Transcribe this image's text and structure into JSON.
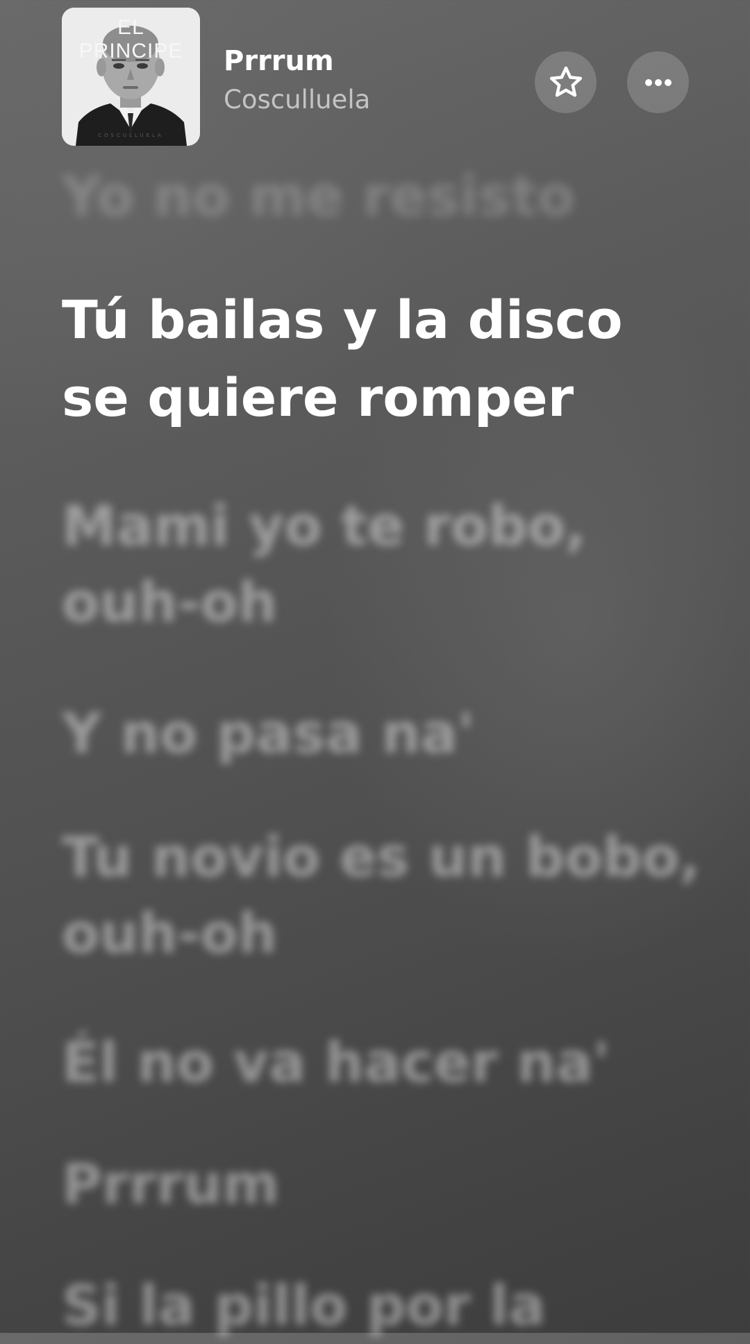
{
  "now_playing": {
    "album_art": {
      "title_text": "EL PRINCIPE",
      "artist_text": "COSCULLUELA"
    },
    "title": "Prrrum",
    "artist": "Cosculluela",
    "favorite_icon": "star-icon",
    "more_icon": "ellipsis-icon"
  },
  "lyrics": {
    "previous": "Yo no me resisto",
    "current": "Tú bailas y la disco se quiere romper",
    "upcoming": [
      "Mami yo te robo, ouh-oh",
      "Y no pasa na'",
      "Tu novio es un bobo, ouh-oh",
      "Él no va hacer na'",
      "Prrrum",
      "Si la pillo por la"
    ]
  },
  "colors": {
    "background": "#555555",
    "active_lyric": "#ffffff"
  }
}
